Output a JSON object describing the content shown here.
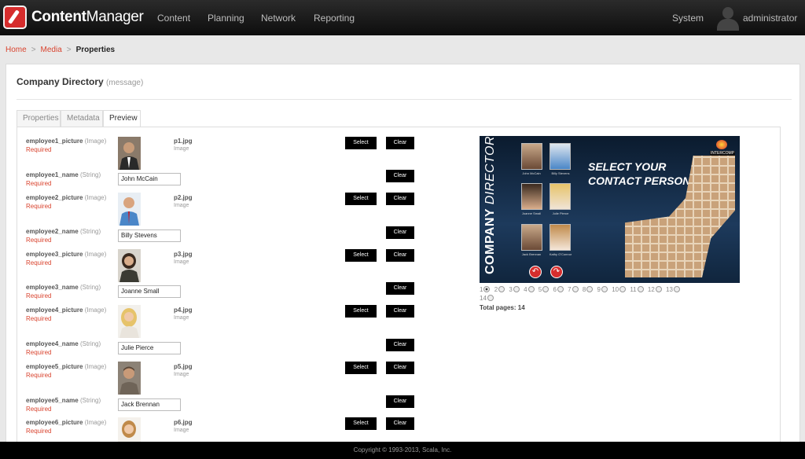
{
  "app": {
    "brand_bold": "Content",
    "brand_rest": "Manager"
  },
  "nav": {
    "items": [
      "Content",
      "Planning",
      "Network",
      "Reporting"
    ],
    "system": "System",
    "user": "administrator"
  },
  "breadcrumb": {
    "home": "Home",
    "media": "Media",
    "current": "Properties"
  },
  "page": {
    "title": "Company Directory",
    "subtitle": "(message)"
  },
  "tabs": [
    "Properties",
    "Metadata",
    "Preview"
  ],
  "labels": {
    "select": "Select",
    "clear": "Clear",
    "required": "Required",
    "image_type": "(Image)",
    "string_type": "(String)",
    "image_word": "Image"
  },
  "employees": [
    {
      "pic_field": "employee1_picture",
      "file": "p1.jpg",
      "name_field": "employee1_name",
      "name": "John McCain"
    },
    {
      "pic_field": "employee2_picture",
      "file": "p2.jpg",
      "name_field": "employee2_name",
      "name": "Billy Stevens"
    },
    {
      "pic_field": "employee3_picture",
      "file": "p3.jpg",
      "name_field": "employee3_name",
      "name": "Joanne Small"
    },
    {
      "pic_field": "employee4_picture",
      "file": "p4.jpg",
      "name_field": "employee4_name",
      "name": "Julie Pierce"
    },
    {
      "pic_field": "employee5_picture",
      "file": "p5.jpg",
      "name_field": "employee5_name",
      "name": "Jack Brennan"
    },
    {
      "pic_field": "employee6_picture",
      "file": "p6.jpg"
    }
  ],
  "preview": {
    "vertical_bold": "COMPANY",
    "vertical_rest": "DIRECTORY",
    "headline_1": "SELECT YOUR",
    "headline_2": "CONTACT PERSON",
    "captions": [
      "John McCain",
      "Billy Stevens",
      "Joanne Small",
      "Julie Pierce",
      "Jack Brennan",
      "Kathy O'Connor"
    ]
  },
  "pagination": {
    "pages": [
      "1",
      "2",
      "3",
      "4",
      "5",
      "6",
      "7",
      "8",
      "9",
      "10",
      "11",
      "12",
      "13",
      "14"
    ],
    "selected": "1",
    "total_label": "Total pages: 14"
  },
  "footer": "Copyright © 1993-2013, Scala, Inc."
}
